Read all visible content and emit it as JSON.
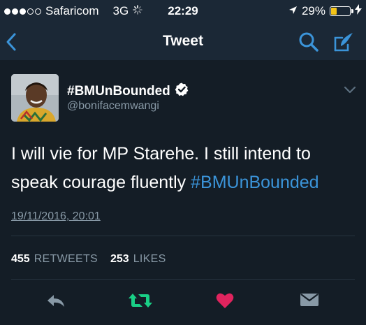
{
  "status_bar": {
    "carrier": "Safaricom",
    "network": "3G",
    "time": "22:29",
    "battery": "29%",
    "battery_level": 0.29,
    "signal_bars_filled": 3,
    "signal_bars_total": 5
  },
  "nav": {
    "title": "Tweet",
    "back_icon": "chevron-left-icon",
    "search_icon": "search-icon",
    "compose_icon": "compose-icon"
  },
  "tweet": {
    "display_name": "#BMUnBounded",
    "handle": "@bonifacemwangi",
    "text": "I will vie for MP Starehe. I still intend to speak courage fluently ",
    "hashtag": "#BMUnBounded",
    "timestamp": "19/11/2016, 20:01",
    "retweets_count": "455",
    "retweets_label": "RETWEETS",
    "likes_count": "253",
    "likes_label": "LIKES"
  },
  "colors": {
    "background": "#141d26",
    "bar": "#1b2836",
    "accent_blue": "#3b94d9",
    "secondary_text": "#8899a6",
    "retweet_green": "#19cf86",
    "like_red": "#e0245e",
    "battery_yellow": "#f5c518"
  }
}
